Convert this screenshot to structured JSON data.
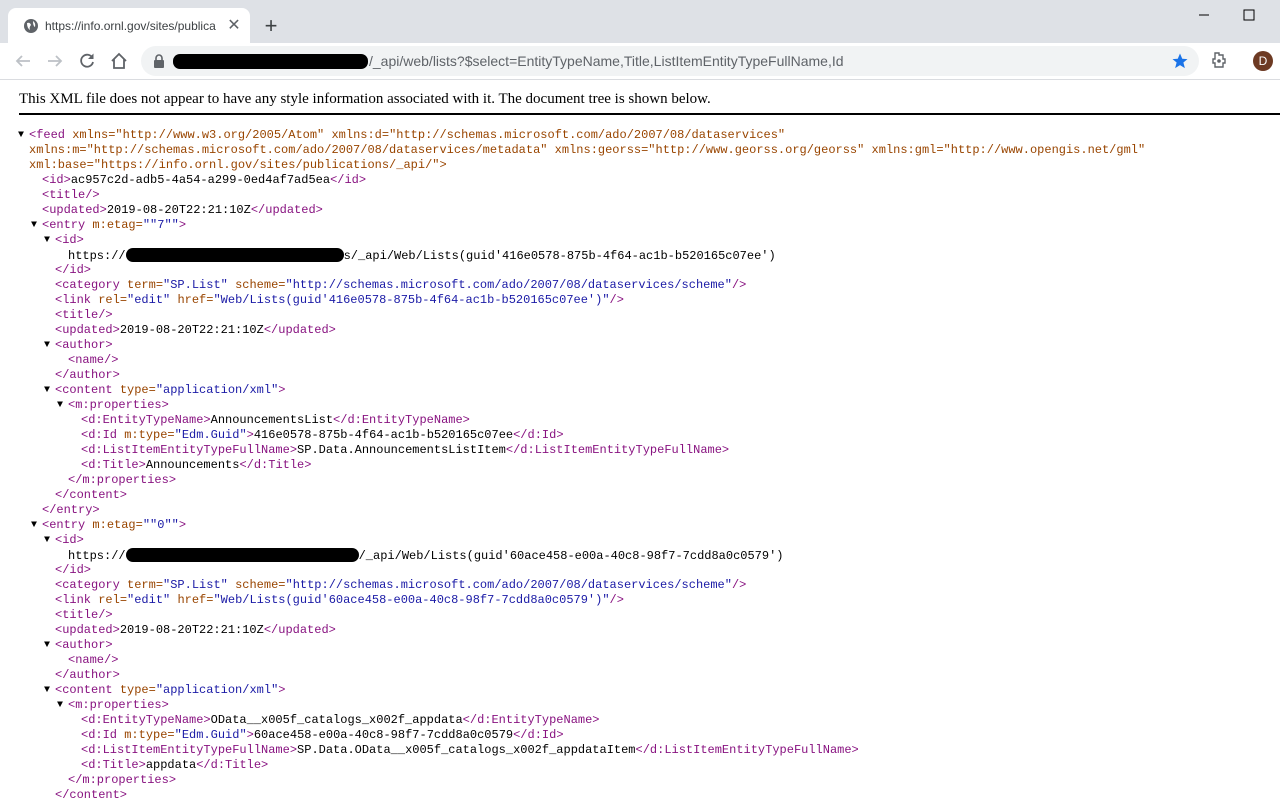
{
  "tab": {
    "title": "https://info.ornl.gov/sites/publica"
  },
  "toolbar": {
    "url_suffix": "/_api/web/lists?$select=EntityTypeName,Title,ListItemEntityTypeFullName,Id"
  },
  "profile": {
    "initial": "D",
    "color": "#6d3a23"
  },
  "notice": "This XML file does not appear to have any style information associated with it. The document tree is shown below.",
  "feed": {
    "open_line1_attrs": "xmlns=\"http://www.w3.org/2005/Atom\" xmlns:d=\"http://schemas.microsoft.com/ado/2007/08/dataservices\"",
    "open_line2": "xmlns:m=\"http://schemas.microsoft.com/ado/2007/08/dataservices/metadata\" xmlns:georss=\"http://www.georss.org/georss\" xmlns:gml=\"http://www.opengis.net/gml\"",
    "open_line3": "xml:base=\"https://info.ornl.gov/sites/publications/_api/\">",
    "id": "ac957c2d-adb5-4a54-a299-0ed4af7ad5ea",
    "updated": "2019-08-20T22:21:10Z"
  },
  "entries": [
    {
      "etag": "\"7\"",
      "id_prefix": "https://",
      "id_suffix": "s/_api/Web/Lists(guid'416e0578-875b-4f64-ac1b-b520165c07ee')",
      "link_href": "Web/Lists(guid'416e0578-875b-4f64-ac1b-b520165c07ee')",
      "updated": "2019-08-20T22:21:10Z",
      "entity_type_name": "AnnouncementsList",
      "guid": "416e0578-875b-4f64-ac1b-b520165c07ee",
      "full_name": "SP.Data.AnnouncementsListItem",
      "title": "Announcements"
    },
    {
      "etag": "\"0\"",
      "id_prefix": "https://",
      "id_suffix": "/_api/Web/Lists(guid'60ace458-e00a-40c8-98f7-7cdd8a0c0579')",
      "link_href": "Web/Lists(guid'60ace458-e00a-40c8-98f7-7cdd8a0c0579')",
      "updated": "2019-08-20T22:21:10Z",
      "entity_type_name": "OData__x005f_catalogs_x002f_appdata",
      "guid": "60ace458-e00a-40c8-98f7-7cdd8a0c0579",
      "full_name": "SP.Data.OData__x005f_catalogs_x002f_appdataItem",
      "title": "appdata"
    }
  ],
  "common": {
    "category_term": "SP.List",
    "category_scheme": "http://schemas.microsoft.com/ado/2007/08/dataservices/scheme",
    "content_type": "application/xml",
    "guid_type": "Edm.Guid",
    "rel": "edit"
  }
}
